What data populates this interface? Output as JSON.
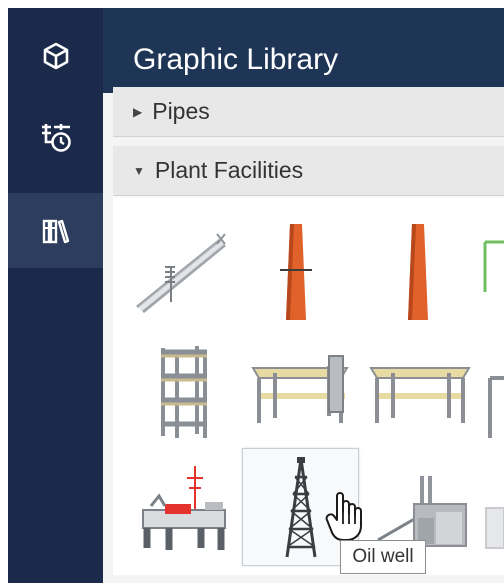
{
  "panel": {
    "title": "Graphic Library"
  },
  "sidebar": {
    "items": [
      {
        "icon": "cube-icon",
        "active": false
      },
      {
        "icon": "plant-timer-icon",
        "active": false
      },
      {
        "icon": "library-icon",
        "active": true
      }
    ]
  },
  "sections": [
    {
      "label": "Pipes",
      "expanded": false
    },
    {
      "label": "Plant Facilities",
      "expanded": true
    }
  ],
  "library_items": [
    {
      "icon": "staircase-icon"
    },
    {
      "icon": "chimney-icon"
    },
    {
      "icon": "chimney-icon"
    },
    {
      "icon": "partial-frame-icon"
    },
    {
      "icon": "shelf-tower-icon"
    },
    {
      "icon": "workbench-icon"
    },
    {
      "icon": "workbench-icon"
    },
    {
      "icon": "partial-frame-icon"
    },
    {
      "icon": "offshore-platform-icon"
    },
    {
      "icon": "oil-well-icon",
      "hovered": true
    },
    {
      "icon": "factory-icon"
    }
  ],
  "tooltip": {
    "text": "Oil well"
  },
  "colors": {
    "rail_bg": "#1b2a4a",
    "rail_active": "#2d3d5d",
    "header_bg": "#1f3556",
    "chimney": "#e0622a",
    "accent_red": "#e5322d"
  }
}
